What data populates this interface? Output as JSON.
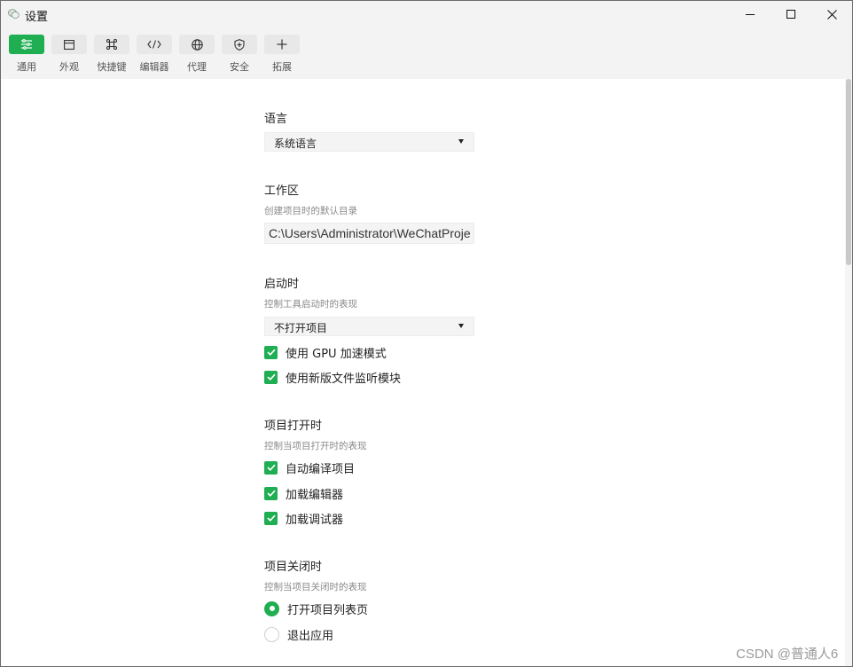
{
  "window": {
    "title": "设置"
  },
  "toolbar": {
    "items": [
      {
        "label": "通用",
        "icon": "sliders-icon",
        "active": true
      },
      {
        "label": "外观",
        "icon": "layout-icon",
        "active": false
      },
      {
        "label": "快捷键",
        "icon": "command-key-icon",
        "active": false
      },
      {
        "label": "编辑器",
        "icon": "code-icon",
        "active": false
      },
      {
        "label": "代理",
        "icon": "globe-icon",
        "active": false
      },
      {
        "label": "安全",
        "icon": "shield-icon",
        "active": false
      },
      {
        "label": "拓展",
        "icon": "plus-icon",
        "active": false
      }
    ],
    "accent_color": "#1fae52"
  },
  "language": {
    "title": "语言",
    "selected": "系统语言"
  },
  "workspace": {
    "title": "工作区",
    "description": "创建项目时的默认目录",
    "path": "C:\\Users\\Administrator\\WeChatProje"
  },
  "startup": {
    "title": "启动时",
    "description": "控制工具启动时的表现",
    "selected": "不打开项目",
    "options": [
      {
        "label": "使用 GPU 加速模式",
        "checked": true
      },
      {
        "label": "使用新版文件监听模块",
        "checked": true
      }
    ]
  },
  "project_open": {
    "title": "项目打开时",
    "description": "控制当项目打开时的表现",
    "options": [
      {
        "label": "自动编译项目",
        "checked": true
      },
      {
        "label": "加载编辑器",
        "checked": true
      },
      {
        "label": "加载调试器",
        "checked": true
      }
    ]
  },
  "project_close": {
    "title": "项目关闭时",
    "description": "控制当项目关闭时的表现",
    "options": [
      {
        "label": "打开项目列表页",
        "selected": true
      },
      {
        "label": "退出应用",
        "selected": false
      }
    ]
  },
  "watermark": "CSDN @普通人6"
}
